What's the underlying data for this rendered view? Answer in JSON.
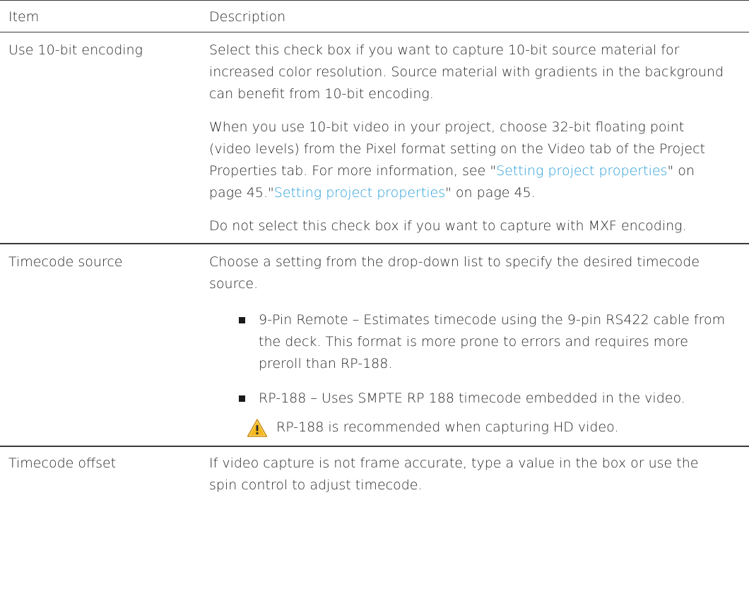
{
  "header": {
    "item": "Item",
    "description": "Description"
  },
  "rows": [
    {
      "item": "Use 10-bit encoding",
      "p1": "Select this check box if you want to capture 10-bit source material for increased color resolution. Source material with gradients in the background can benefit from 10-bit encoding.",
      "p2_pre": "When you use 10-bit video in your project, choose 32-bit floating point (video levels) from the Pixel format setting on the Video tab of the Project Properties tab. For more information, see \"",
      "p2_link1": "Setting project properties",
      "p2_mid": "\" on page 45.\"",
      "p2_link2": "Setting project properties",
      "p2_post": "\" on page 45.",
      "p3": "Do not select this check box if you want to capture with MXF encoding."
    },
    {
      "item": "Timecode source",
      "p1": "Choose a setting from the drop-down list to specify the desired timecode source.",
      "bullets": [
        "9-Pin Remote – Estimates timecode using the 9-pin RS422 cable from the deck. This format is more prone to errors and requires more preroll than RP-188.",
        "RP-188 – Uses SMPTE RP 188 timecode embedded in the video."
      ],
      "note": "RP-188 is recommended when capturing HD video.",
      "note_icon": "warning-icon"
    },
    {
      "item": "Timecode offset",
      "p1": "If video capture is not frame accurate, type a value in the box or use the spin control to adjust timecode."
    }
  ],
  "colors": {
    "link": "#2a9fd8",
    "warning_fill": "#f5b81c",
    "text": "#262626"
  }
}
